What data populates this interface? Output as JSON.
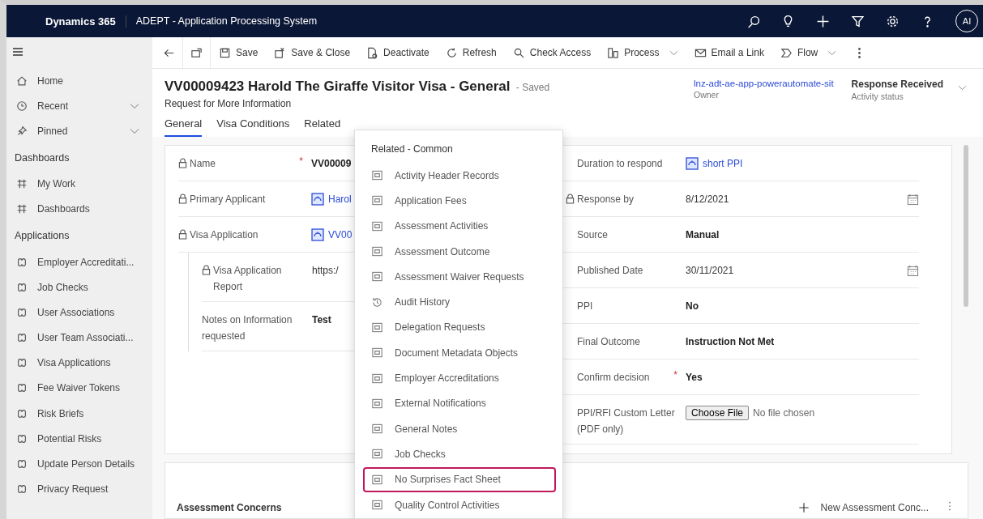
{
  "header": {
    "brand": "Dynamics 365",
    "app_title": "ADEPT - Application Processing System",
    "avatar": "AI"
  },
  "sidebar": {
    "groups": [
      {
        "items": [
          {
            "kind": "home",
            "label": "Home"
          },
          {
            "kind": "recent",
            "label": "Recent"
          },
          {
            "kind": "pinned",
            "label": "Pinned"
          }
        ]
      },
      {
        "title": "Dashboards",
        "items": [
          {
            "kind": "dashboard",
            "label": "My Work"
          },
          {
            "kind": "dashboard",
            "label": "Dashboards"
          }
        ]
      },
      {
        "title": "Applications",
        "items": [
          {
            "kind": "entity",
            "label": "Employer Accreditati..."
          },
          {
            "kind": "entity",
            "label": "Job Checks"
          },
          {
            "kind": "entity",
            "label": "User Associations"
          },
          {
            "kind": "entity",
            "label": "User Team Associati..."
          },
          {
            "kind": "entity",
            "label": "Visa Applications"
          },
          {
            "kind": "entity",
            "label": "Fee Waiver Tokens"
          },
          {
            "kind": "entity",
            "label": "Risk Briefs"
          },
          {
            "kind": "entity",
            "label": "Potential Risks"
          },
          {
            "kind": "entity",
            "label": "Update Person Details"
          },
          {
            "kind": "entity",
            "label": "Privacy Request"
          }
        ]
      }
    ]
  },
  "commands": [
    {
      "kind": "back"
    },
    {
      "kind": "popout"
    },
    {
      "kind": "save",
      "label": "Save"
    },
    {
      "kind": "save-close",
      "label": "Save & Close"
    },
    {
      "kind": "deactivate",
      "label": "Deactivate"
    },
    {
      "kind": "refresh",
      "label": "Refresh"
    },
    {
      "kind": "check-access",
      "label": "Check Access"
    },
    {
      "kind": "process",
      "label": "Process",
      "caret": true
    },
    {
      "kind": "email",
      "label": "Email a Link"
    },
    {
      "kind": "flow",
      "label": "Flow",
      "caret": true
    },
    {
      "kind": "more"
    }
  ],
  "record": {
    "title": "VV00009423 Harold The Giraffe Visitor Visa - General",
    "save_state": "- Saved",
    "subtitle": "Request for More Information",
    "owner": {
      "value": "lnz-adt-ae-app-powerautomate-sit",
      "label": "Owner"
    },
    "status": {
      "value": "Response Received",
      "label": "Activity status"
    }
  },
  "tabs": [
    {
      "label": "General",
      "selected": true
    },
    {
      "label": "Visa Conditions",
      "selected": false
    },
    {
      "label": "Related",
      "selected": false
    }
  ],
  "left_fields": [
    {
      "label": "Name",
      "locked": true,
      "required_mark": "*",
      "kind": "text",
      "value": "VV00009"
    },
    {
      "label": "Primary Applicant",
      "locked": true,
      "kind": "lookup",
      "value": "Harol"
    },
    {
      "label": "Visa Application",
      "locked": true,
      "kind": "lookup",
      "value": "VV00"
    }
  ],
  "sub_fields": [
    {
      "label": "Visa Application Report",
      "locked": true,
      "kind": "url",
      "value": "https:/"
    },
    {
      "label": "Notes on Information requested",
      "locked": false,
      "kind": "text",
      "value": "Test"
    }
  ],
  "right_fields": [
    {
      "label": "Duration to respond",
      "locked": false,
      "kind": "lookup",
      "value": "short PPI"
    },
    {
      "label": "Response by",
      "locked": true,
      "kind": "date",
      "value": "8/12/2021"
    },
    {
      "label": "Source",
      "locked": false,
      "kind": "text",
      "value": "Manual"
    },
    {
      "label": "Published Date",
      "locked": false,
      "kind": "date",
      "value": "30/11/2021"
    },
    {
      "label": "PPI",
      "locked": false,
      "kind": "text",
      "value": "No"
    },
    {
      "label": "Final Outcome",
      "locked": false,
      "kind": "text",
      "value": "Instruction Not Met"
    },
    {
      "label": "Confirm decision",
      "locked": false,
      "required_mark": "*",
      "kind": "text",
      "value": "Yes"
    },
    {
      "label": "PPI/RFI Custom Letter (PDF only)",
      "locked": false,
      "kind": "file",
      "button": "Choose File",
      "value": "No file chosen"
    }
  ],
  "assessment": {
    "title": "Assessment Concerns",
    "new_button": "New Assessment Conc..."
  },
  "related_menu": {
    "header": "Related - Common",
    "items": [
      {
        "kind": "entity",
        "label": "Activity Header Records",
        "selected": false
      },
      {
        "kind": "entity",
        "label": "Application Fees",
        "selected": false
      },
      {
        "kind": "entity",
        "label": "Assessment Activities",
        "selected": false
      },
      {
        "kind": "entity",
        "label": "Assessment Outcome",
        "selected": false
      },
      {
        "kind": "entity",
        "label": "Assessment Waiver Requests",
        "selected": false
      },
      {
        "kind": "history",
        "label": "Audit History",
        "selected": false
      },
      {
        "kind": "entity",
        "label": "Delegation Requests",
        "selected": false
      },
      {
        "kind": "entity",
        "label": "Document Metadata Objects",
        "selected": false
      },
      {
        "kind": "entity",
        "label": "Employer Accreditations",
        "selected": false
      },
      {
        "kind": "entity",
        "label": "External Notifications",
        "selected": false
      },
      {
        "kind": "entity",
        "label": "General Notes",
        "selected": false
      },
      {
        "kind": "entity",
        "label": "Job Checks",
        "selected": false
      },
      {
        "kind": "entity",
        "label": "No Surprises Fact Sheet",
        "selected": true
      },
      {
        "kind": "entity",
        "label": "Quality Control Activities",
        "selected": false
      }
    ]
  }
}
